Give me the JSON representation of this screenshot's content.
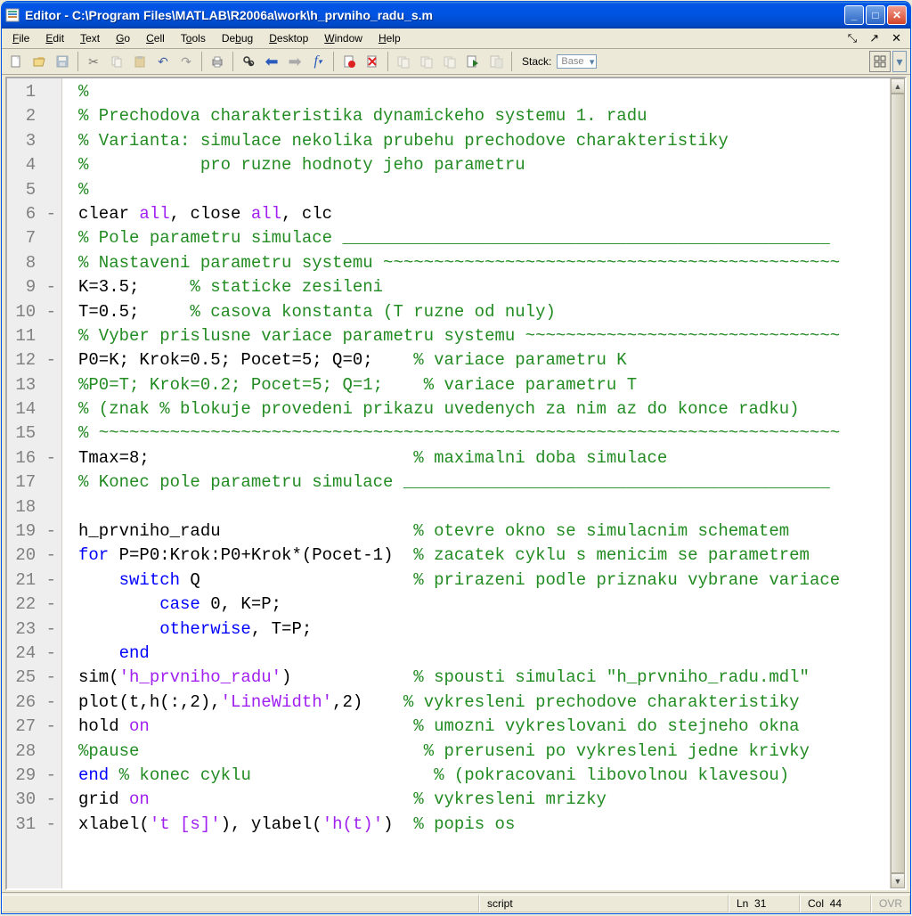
{
  "window": {
    "title": "Editor - C:\\Program Files\\MATLAB\\R2006a\\work\\h_prvniho_radu_s.m"
  },
  "menu": {
    "file": "File",
    "edit": "Edit",
    "text": "Text",
    "go": "Go",
    "cell": "Cell",
    "tools": "Tools",
    "debug": "Debug",
    "desktop": "Desktop",
    "window": "Window",
    "help": "Help"
  },
  "toolbar": {
    "stack_label": "Stack:",
    "stack_value": "Base"
  },
  "code_lines": [
    {
      "n": "1",
      "dash": " ",
      "seg": [
        {
          "c": "cm",
          "t": "%"
        }
      ]
    },
    {
      "n": "2",
      "dash": " ",
      "seg": [
        {
          "c": "cm",
          "t": "% Prechodova charakteristika dynamickeho systemu 1. radu"
        }
      ]
    },
    {
      "n": "3",
      "dash": " ",
      "seg": [
        {
          "c": "cm",
          "t": "% Varianta: simulace nekolika prubehu prechodove charakteristiky"
        }
      ]
    },
    {
      "n": "4",
      "dash": " ",
      "seg": [
        {
          "c": "cm",
          "t": "%           pro ruzne hodnoty jeho parametru"
        }
      ]
    },
    {
      "n": "5",
      "dash": " ",
      "seg": [
        {
          "c": "cm",
          "t": "%"
        }
      ]
    },
    {
      "n": "6",
      "dash": "-",
      "seg": [
        {
          "c": "",
          "t": "clear "
        },
        {
          "c": "st",
          "t": "all"
        },
        {
          "c": "",
          "t": ", close "
        },
        {
          "c": "st",
          "t": "all"
        },
        {
          "c": "",
          "t": ", clc"
        }
      ]
    },
    {
      "n": "7",
      "dash": " ",
      "seg": [
        {
          "c": "cm",
          "t": "% Pole parametru simulace ________________________________________________"
        }
      ]
    },
    {
      "n": "8",
      "dash": " ",
      "seg": [
        {
          "c": "cm",
          "t": "% Nastaveni parametru systemu ~~~~~~~~~~~~~~~~~~~~~~~~~~~~~~~~~~~~~~~~~~~~~"
        }
      ]
    },
    {
      "n": "9",
      "dash": "-",
      "seg": [
        {
          "c": "",
          "t": "K=3.5;     "
        },
        {
          "c": "cm",
          "t": "% staticke zesileni"
        }
      ]
    },
    {
      "n": "10",
      "dash": "-",
      "seg": [
        {
          "c": "",
          "t": "T=0.5;     "
        },
        {
          "c": "cm",
          "t": "% casova konstanta (T ruzne od nuly)"
        }
      ]
    },
    {
      "n": "11",
      "dash": " ",
      "seg": [
        {
          "c": "cm",
          "t": "% Vyber prislusne variace parametru systemu ~~~~~~~~~~~~~~~~~~~~~~~~~~~~~~~"
        }
      ]
    },
    {
      "n": "12",
      "dash": "-",
      "seg": [
        {
          "c": "",
          "t": "P0=K; Krok=0.5; Pocet=5; Q=0;    "
        },
        {
          "c": "cm",
          "t": "% variace parametru K"
        }
      ]
    },
    {
      "n": "13",
      "dash": " ",
      "seg": [
        {
          "c": "cm",
          "t": "%P0=T; Krok=0.2; Pocet=5; Q=1;    % variace parametru T"
        }
      ]
    },
    {
      "n": "14",
      "dash": " ",
      "seg": [
        {
          "c": "cm",
          "t": "% (znak % blokuje provedeni prikazu uvedenych za nim az do konce radku)"
        }
      ]
    },
    {
      "n": "15",
      "dash": " ",
      "seg": [
        {
          "c": "cm",
          "t": "% ~~~~~~~~~~~~~~~~~~~~~~~~~~~~~~~~~~~~~~~~~~~~~~~~~~~~~~~~~~~~~~~~~~~~~~~~~"
        }
      ]
    },
    {
      "n": "16",
      "dash": "-",
      "seg": [
        {
          "c": "",
          "t": "Tmax=8;                          "
        },
        {
          "c": "cm",
          "t": "% maximalni doba simulace"
        }
      ]
    },
    {
      "n": "17",
      "dash": " ",
      "seg": [
        {
          "c": "cm",
          "t": "% Konec pole parametru simulace __________________________________________"
        }
      ]
    },
    {
      "n": "18",
      "dash": " ",
      "seg": [
        {
          "c": "",
          "t": ""
        }
      ]
    },
    {
      "n": "19",
      "dash": "-",
      "seg": [
        {
          "c": "",
          "t": "h_prvniho_radu                   "
        },
        {
          "c": "cm",
          "t": "% otevre okno se simulacnim schematem"
        }
      ]
    },
    {
      "n": "20",
      "dash": "-",
      "seg": [
        {
          "c": "kw",
          "t": "for"
        },
        {
          "c": "",
          "t": " P=P0:Krok:P0+Krok*(Pocet-1)  "
        },
        {
          "c": "cm",
          "t": "% zacatek cyklu s menicim se parametrem"
        }
      ]
    },
    {
      "n": "21",
      "dash": "-",
      "seg": [
        {
          "c": "",
          "t": "    "
        },
        {
          "c": "kw",
          "t": "switch"
        },
        {
          "c": "",
          "t": " Q                     "
        },
        {
          "c": "cm",
          "t": "% prirazeni podle priznaku vybrane variace"
        }
      ]
    },
    {
      "n": "22",
      "dash": "-",
      "seg": [
        {
          "c": "",
          "t": "        "
        },
        {
          "c": "kw",
          "t": "case"
        },
        {
          "c": "",
          "t": " 0, K=P;"
        }
      ]
    },
    {
      "n": "23",
      "dash": "-",
      "seg": [
        {
          "c": "",
          "t": "        "
        },
        {
          "c": "kw",
          "t": "otherwise"
        },
        {
          "c": "",
          "t": ", T=P;"
        }
      ]
    },
    {
      "n": "24",
      "dash": "-",
      "seg": [
        {
          "c": "",
          "t": "    "
        },
        {
          "c": "kw",
          "t": "end"
        }
      ]
    },
    {
      "n": "25",
      "dash": "-",
      "seg": [
        {
          "c": "",
          "t": "sim("
        },
        {
          "c": "st",
          "t": "'h_prvniho_radu'"
        },
        {
          "c": "",
          "t": ")            "
        },
        {
          "c": "cm",
          "t": "% spousti simulaci \"h_prvniho_radu.mdl\""
        }
      ]
    },
    {
      "n": "26",
      "dash": "-",
      "seg": [
        {
          "c": "",
          "t": "plot(t,h(:,2),"
        },
        {
          "c": "st",
          "t": "'LineWidth'"
        },
        {
          "c": "",
          "t": ",2)    "
        },
        {
          "c": "cm",
          "t": "% vykresleni prechodove charakteristiky"
        }
      ]
    },
    {
      "n": "27",
      "dash": "-",
      "seg": [
        {
          "c": "",
          "t": "hold "
        },
        {
          "c": "st",
          "t": "on"
        },
        {
          "c": "",
          "t": "                          "
        },
        {
          "c": "cm",
          "t": "% umozni vykreslovani do stejneho okna"
        }
      ]
    },
    {
      "n": "28",
      "dash": " ",
      "seg": [
        {
          "c": "cm",
          "t": "%pause                            % preruseni po vykresleni jedne krivky"
        }
      ]
    },
    {
      "n": "29",
      "dash": "-",
      "seg": [
        {
          "c": "kw",
          "t": "end"
        },
        {
          "c": "",
          "t": " "
        },
        {
          "c": "cm",
          "t": "% konec cyklu                  % (pokracovani libovolnou klavesou)"
        }
      ]
    },
    {
      "n": "30",
      "dash": "-",
      "seg": [
        {
          "c": "",
          "t": "grid "
        },
        {
          "c": "st",
          "t": "on"
        },
        {
          "c": "",
          "t": "                          "
        },
        {
          "c": "cm",
          "t": "% vykresleni mrizky"
        }
      ]
    },
    {
      "n": "31",
      "dash": "-",
      "seg": [
        {
          "c": "",
          "t": "xlabel("
        },
        {
          "c": "st",
          "t": "'t [s]'"
        },
        {
          "c": "",
          "t": "), ylabel("
        },
        {
          "c": "st",
          "t": "'h(t)'"
        },
        {
          "c": "",
          "t": ")  "
        },
        {
          "c": "cm",
          "t": "% popis os"
        }
      ]
    }
  ],
  "status": {
    "type": "script",
    "line_label": "Ln",
    "line": "31",
    "col_label": "Col",
    "col": "44",
    "ovr": "OVR"
  }
}
